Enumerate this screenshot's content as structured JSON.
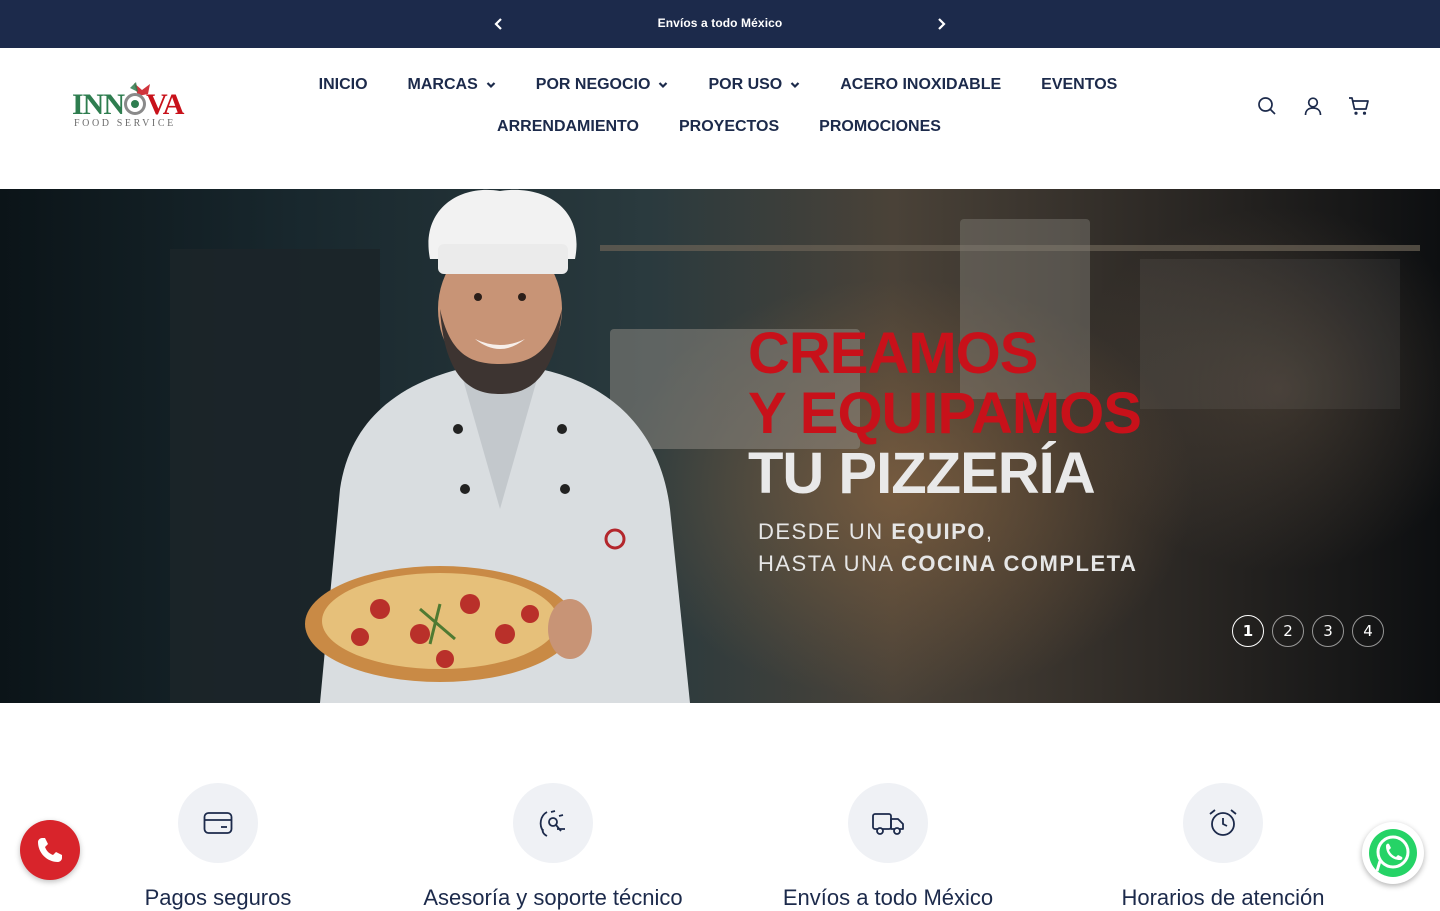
{
  "announcement": {
    "text": "Envíos a todo México",
    "prev_icon": "chevron-left-icon",
    "next_icon": "chevron-right-icon"
  },
  "logo": {
    "brand": "INNOVA",
    "tagline": "FOOD SERVICE",
    "colors": {
      "green": "#2e7d4f",
      "red": "#c8111a",
      "grey": "#6d6d6d"
    }
  },
  "nav": {
    "row1": [
      {
        "label": "INICIO",
        "dropdown": false
      },
      {
        "label": "MARCAS",
        "dropdown": true
      },
      {
        "label": "POR NEGOCIO",
        "dropdown": true
      },
      {
        "label": "POR USO",
        "dropdown": true
      },
      {
        "label": "ACERO INOXIDABLE",
        "dropdown": false
      },
      {
        "label": "EVENTOS",
        "dropdown": false
      }
    ],
    "row2": [
      {
        "label": "ARRENDAMIENTO",
        "dropdown": false
      },
      {
        "label": "PROYECTOS",
        "dropdown": false
      },
      {
        "label": "PROMOCIONES",
        "dropdown": false
      }
    ]
  },
  "header_icons": [
    "search-icon",
    "account-icon",
    "cart-icon"
  ],
  "hero": {
    "line1": "CREAMOS",
    "line2": "Y EQUIPAMOS",
    "line3": "TU PIZZERÍA",
    "sub1_pre": "DESDE UN ",
    "sub1_bold": "EQUIPO",
    "sub1_post": ",",
    "sub2_pre": "HASTA UNA ",
    "sub2_bold": "COCINA COMPLETA",
    "slides": [
      "1",
      "2",
      "3",
      "4"
    ],
    "active_slide": 1
  },
  "features": [
    {
      "title": "Pagos seguros",
      "icon": "credit-card-icon"
    },
    {
      "title": "Asesoría y soporte técnico",
      "icon": "support-icon"
    },
    {
      "title": "Envíos a todo México",
      "icon": "delivery-truck-icon"
    },
    {
      "title": "Horarios de atención",
      "icon": "alarm-clock-icon"
    }
  ],
  "colors": {
    "navy": "#1c2a4b",
    "hero_red": "#c8111a",
    "call_red": "#d8242b",
    "whatsapp_green": "#25d366"
  }
}
